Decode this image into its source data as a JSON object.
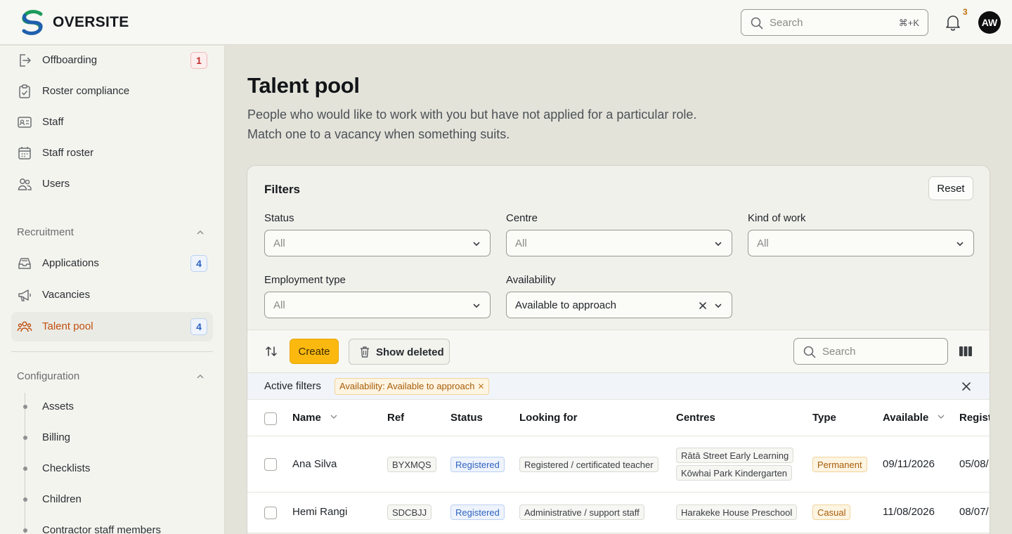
{
  "header": {
    "brand": "OVERSITE",
    "search_placeholder": "Search",
    "search_shortcut": "⌘+K",
    "notification_count": "3",
    "avatar_initials": "AW",
    "logo_colors": [
      "#1b9a5a",
      "#1f5fae"
    ]
  },
  "sidebar": {
    "top_items": [
      {
        "label": "Offboarding",
        "icon": "logout-icon",
        "badge": "1"
      },
      {
        "label": "Roster compliance",
        "icon": "clipboard-check-icon"
      },
      {
        "label": "Staff",
        "icon": "id-card-icon"
      },
      {
        "label": "Staff roster",
        "icon": "calendar-icon"
      },
      {
        "label": "Users",
        "icon": "users-icon"
      }
    ],
    "recruitment": {
      "heading": "Recruitment",
      "items": [
        {
          "label": "Applications",
          "icon": "inbox-icon",
          "badge": "4"
        },
        {
          "label": "Vacancies",
          "icon": "megaphone-icon"
        },
        {
          "label": "Talent pool",
          "icon": "people-group-icon",
          "badge": "4",
          "active": true
        }
      ]
    },
    "configuration": {
      "heading": "Configuration",
      "items": [
        "Assets",
        "Billing",
        "Checklists",
        "Children",
        "Contractor staff members"
      ]
    },
    "accent_color": "#c0500f"
  },
  "main": {
    "title": "Talent pool",
    "description": "People who would like to work with you but have not applied for a particular role. Match one to a vacancy when something suits."
  },
  "filters": {
    "title": "Filters",
    "reset_label": "Reset",
    "fields": {
      "status": {
        "label": "Status",
        "value": "All"
      },
      "centre": {
        "label": "Centre",
        "value": "All"
      },
      "kind_of_work": {
        "label": "Kind of work",
        "value": "All"
      },
      "employment_type": {
        "label": "Employment type",
        "value": "All"
      },
      "availability": {
        "label": "Availability",
        "value": "Available to approach"
      }
    }
  },
  "toolbar": {
    "create_label": "Create",
    "show_deleted_label": "Show deleted",
    "search_placeholder": "Search",
    "create_color": "#fbb90f"
  },
  "active_filters": {
    "label": "Active filters",
    "chips": [
      "Availability: Available to approach"
    ]
  },
  "table": {
    "columns": {
      "name": "Name",
      "ref": "Ref",
      "status": "Status",
      "looking_for": "Looking for",
      "centres": "Centres",
      "type": "Type",
      "available": "Available",
      "registered": "Regist"
    },
    "rows": [
      {
        "name": "Ana Silva",
        "ref": "BYXMQS",
        "status": "Registered",
        "looking_for": "Registered / certificated teacher",
        "centres": [
          "Rātā Street Early Learning",
          "Kōwhai Park Kindergarten"
        ],
        "type": "Permanent",
        "available": "09/11/2026",
        "registered": "05/08/"
      },
      {
        "name": "Hemi Rangi",
        "ref": "SDCBJJ",
        "status": "Registered",
        "looking_for": "Administrative / support staff",
        "centres": [
          "Harakeke House Preschool"
        ],
        "type": "Casual",
        "available": "11/08/2026",
        "registered": "08/07/"
      }
    ]
  }
}
